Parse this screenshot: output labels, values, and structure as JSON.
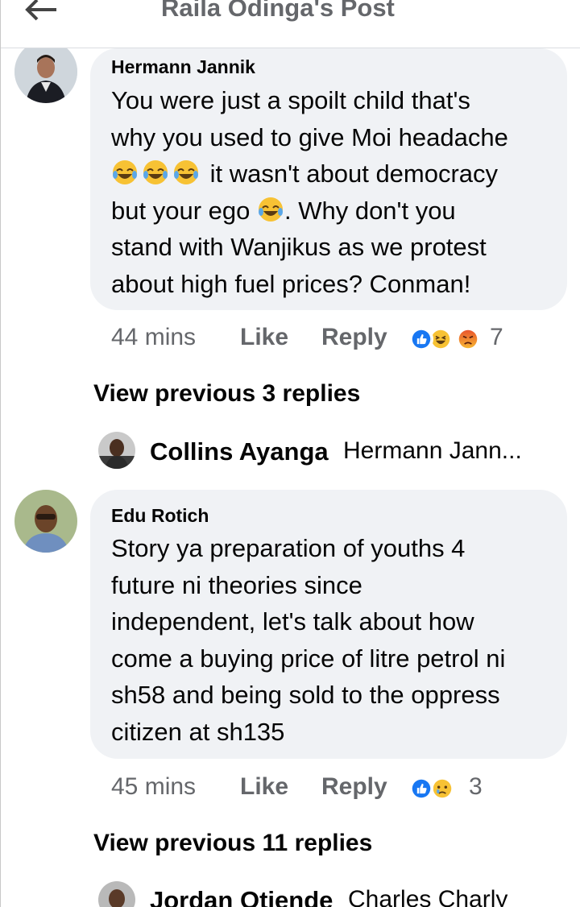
{
  "header": {
    "title": "Raila Odinga's Post",
    "back_icon": "back-arrow-icon"
  },
  "comments": [
    {
      "author": "Hermann Jannik",
      "lines": [
        "You were just a spoilt child that's",
        "why you used to give Moi headache",
        "it wasn't about democracy",
        "but your ego",
        ". Why don't you",
        "stand with Wanjikus as we protest",
        "about high fuel prices? Conman!"
      ],
      "time": "44 mins",
      "like_label": "Like",
      "reply_label": "Reply",
      "reaction_count": "7",
      "reactions": [
        "like-reaction-icon",
        "haha-reaction-icon",
        "angry-reaction-icon"
      ],
      "view_previous": "View previous 3 replies",
      "reply_preview": {
        "name": "Collins Ayanga",
        "text": "Hermann Jann..."
      }
    },
    {
      "author": "Edu Rotich",
      "lines": [
        "Story ya preparation of youths 4",
        "future ni theories since",
        "independent, let's talk about how",
        "come a buying price of litre petrol ni",
        "sh58 and being sold to the oppress",
        "citizen at sh135"
      ],
      "time": "45 mins",
      "like_label": "Like",
      "reply_label": "Reply",
      "reaction_count": "3",
      "reactions": [
        "like-reaction-icon",
        "sad-reaction-icon"
      ],
      "view_previous": "View previous 11 replies",
      "reply_preview": {
        "name": "Jordan Otiende",
        "text": "Charles Charly"
      }
    }
  ],
  "colors": {
    "bubble": "#f0f2f5",
    "meta_gray": "#65676b",
    "like_blue": "#1877f2",
    "text": "#050505"
  }
}
